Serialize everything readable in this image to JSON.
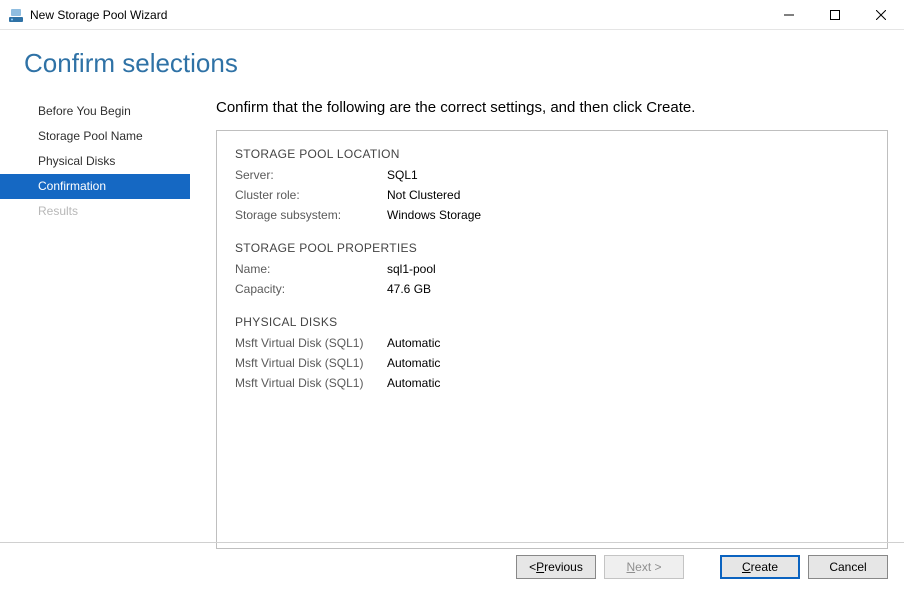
{
  "window": {
    "title": "New Storage Pool Wizard"
  },
  "heading": "Confirm selections",
  "sidebar": {
    "items": [
      {
        "label": "Before You Begin",
        "state": "normal"
      },
      {
        "label": "Storage Pool Name",
        "state": "normal"
      },
      {
        "label": "Physical Disks",
        "state": "normal"
      },
      {
        "label": "Confirmation",
        "state": "selected"
      },
      {
        "label": "Results",
        "state": "disabled"
      }
    ]
  },
  "main": {
    "instruction": "Confirm that the following are the correct settings, and then click Create.",
    "sections": [
      {
        "title": "STORAGE POOL LOCATION",
        "rows": [
          {
            "label": "Server:",
            "value": "SQL1"
          },
          {
            "label": "Cluster role:",
            "value": "Not Clustered"
          },
          {
            "label": "Storage subsystem:",
            "value": "Windows Storage"
          }
        ]
      },
      {
        "title": "STORAGE POOL PROPERTIES",
        "rows": [
          {
            "label": "Name:",
            "value": "sql1-pool"
          },
          {
            "label": "Capacity:",
            "value": "47.6 GB"
          }
        ]
      },
      {
        "title": "PHYSICAL DISKS",
        "rows": [
          {
            "label": "Msft Virtual Disk (SQL1)",
            "value": "Automatic"
          },
          {
            "label": "Msft Virtual Disk (SQL1)",
            "value": "Automatic"
          },
          {
            "label": "Msft Virtual Disk (SQL1)",
            "value": "Automatic"
          }
        ]
      }
    ]
  },
  "footer": {
    "previous_prefix": "< ",
    "previous_u": "P",
    "previous_rest": "revious",
    "next_u": "N",
    "next_rest": "ext >",
    "create_u": "C",
    "create_rest": "reate",
    "cancel": "Cancel"
  }
}
